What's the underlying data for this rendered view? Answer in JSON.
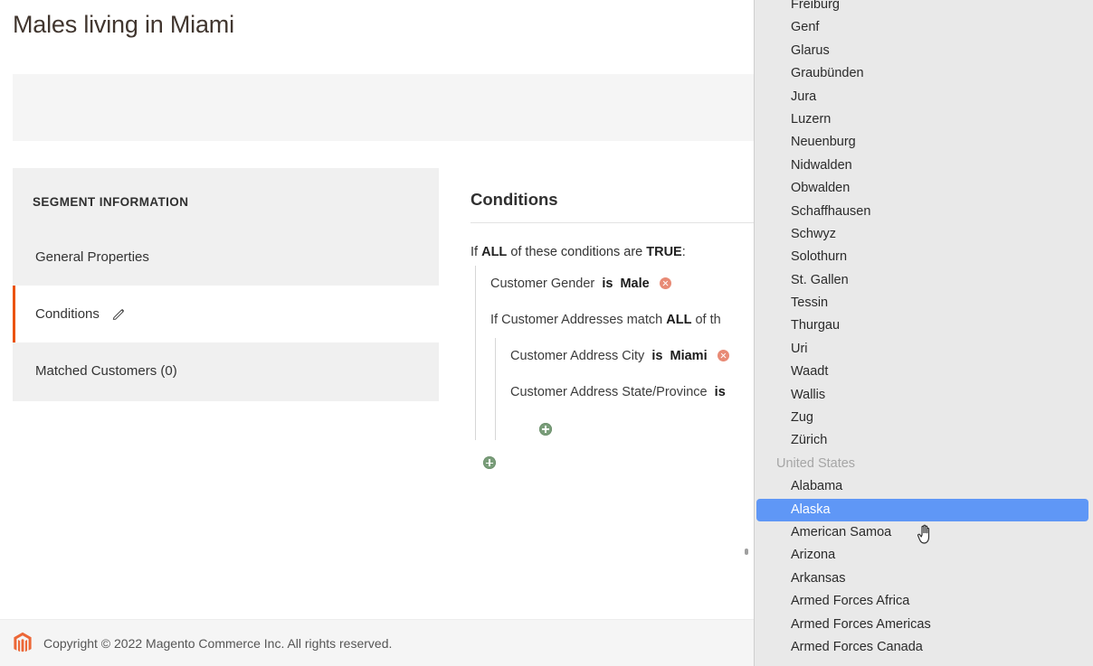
{
  "page": {
    "title": "Males living in Miami"
  },
  "sidebar": {
    "heading": "SEGMENT INFORMATION",
    "items": [
      {
        "label": "General Properties",
        "active": false,
        "icon": null
      },
      {
        "label": "Conditions",
        "active": true,
        "icon": "pencil-icon"
      },
      {
        "label": "Matched Customers (0)",
        "active": false,
        "icon": null
      }
    ]
  },
  "conditions": {
    "heading": "Conditions",
    "root_prefix": "If",
    "root_operator": "ALL",
    "root_mid": "of these conditions are",
    "root_value": "TRUE",
    "root_suffix": ":",
    "rows": [
      {
        "label": "Customer Gender",
        "operator": "is",
        "value": "Male",
        "delete_icon": "delete-circle-icon"
      }
    ],
    "nested": {
      "prefix": "If",
      "subject": "Customer Addresses",
      "match_word": "match",
      "operator": "ALL",
      "suffix": "of th",
      "rows": [
        {
          "label": "Customer Address City",
          "operator": "is",
          "value": "Miami",
          "delete_icon": "delete-circle-icon"
        },
        {
          "label": "Customer Address State/Province",
          "operator": "is",
          "value": "",
          "delete_icon": null
        }
      ],
      "add_icon": "add-circle-icon"
    },
    "add_icon": "add-circle-icon"
  },
  "footer": {
    "logo_icon": "magento-logo-icon",
    "text": "Copyright © 2022 Magento Commerce Inc. All rights reserved."
  },
  "dropdown": {
    "cursor_icon": "hand-pointer-cursor",
    "items": [
      {
        "label": "Freiburg",
        "type": "option",
        "selected": false
      },
      {
        "label": "Genf",
        "type": "option",
        "selected": false
      },
      {
        "label": "Glarus",
        "type": "option",
        "selected": false
      },
      {
        "label": "Graubünden",
        "type": "option",
        "selected": false
      },
      {
        "label": "Jura",
        "type": "option",
        "selected": false
      },
      {
        "label": "Luzern",
        "type": "option",
        "selected": false
      },
      {
        "label": "Neuenburg",
        "type": "option",
        "selected": false
      },
      {
        "label": "Nidwalden",
        "type": "option",
        "selected": false
      },
      {
        "label": "Obwalden",
        "type": "option",
        "selected": false
      },
      {
        "label": "Schaffhausen",
        "type": "option",
        "selected": false
      },
      {
        "label": "Schwyz",
        "type": "option",
        "selected": false
      },
      {
        "label": "Solothurn",
        "type": "option",
        "selected": false
      },
      {
        "label": "St. Gallen",
        "type": "option",
        "selected": false
      },
      {
        "label": "Tessin",
        "type": "option",
        "selected": false
      },
      {
        "label": "Thurgau",
        "type": "option",
        "selected": false
      },
      {
        "label": "Uri",
        "type": "option",
        "selected": false
      },
      {
        "label": "Waadt",
        "type": "option",
        "selected": false
      },
      {
        "label": "Wallis",
        "type": "option",
        "selected": false
      },
      {
        "label": "Zug",
        "type": "option",
        "selected": false
      },
      {
        "label": "Zürich",
        "type": "option",
        "selected": false
      },
      {
        "label": "United States",
        "type": "group",
        "selected": false
      },
      {
        "label": "Alabama",
        "type": "option",
        "selected": false
      },
      {
        "label": "Alaska",
        "type": "option",
        "selected": true
      },
      {
        "label": "American Samoa",
        "type": "option",
        "selected": false
      },
      {
        "label": "Arizona",
        "type": "option",
        "selected": false
      },
      {
        "label": "Arkansas",
        "type": "option",
        "selected": false
      },
      {
        "label": "Armed Forces Africa",
        "type": "option",
        "selected": false
      },
      {
        "label": "Armed Forces Americas",
        "type": "option",
        "selected": false
      },
      {
        "label": "Armed Forces Canada",
        "type": "option",
        "selected": false
      }
    ]
  },
  "colors": {
    "accent_orange": "#eb5202",
    "selection_blue": "#5f97f6",
    "delete_red": "#e88a75",
    "add_green": "#7b9e7b",
    "panel_gray": "#f0f0f0",
    "dropdown_bg": "#e9e9e9"
  }
}
